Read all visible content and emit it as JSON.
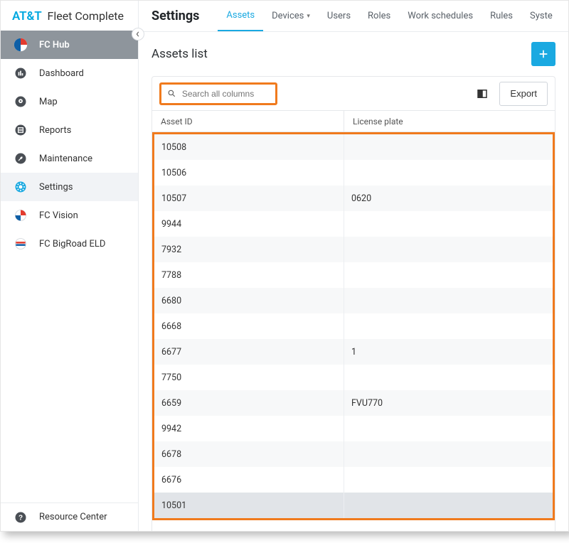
{
  "brand": {
    "att": "AT&T",
    "fc": "Fleet Complete"
  },
  "sidebar": {
    "items": [
      {
        "label": "FC Hub"
      },
      {
        "label": "Dashboard"
      },
      {
        "label": "Map"
      },
      {
        "label": "Reports"
      },
      {
        "label": "Maintenance"
      },
      {
        "label": "Settings"
      },
      {
        "label": "FC Vision"
      },
      {
        "label": "FC BigRoad ELD"
      }
    ],
    "bottom": {
      "label": "Resource Center"
    }
  },
  "topbar": {
    "title": "Settings",
    "tabs": [
      {
        "label": "Assets"
      },
      {
        "label": "Devices"
      },
      {
        "label": "Users"
      },
      {
        "label": "Roles"
      },
      {
        "label": "Work schedules"
      },
      {
        "label": "Rules"
      },
      {
        "label": "Syste"
      }
    ]
  },
  "list": {
    "title": "Assets list",
    "search_placeholder": "Search all columns",
    "export_label": "Export",
    "columns": {
      "asset_id": "Asset ID",
      "license_plate": "License plate"
    },
    "rows": [
      {
        "asset_id": "10508",
        "license_plate": ""
      },
      {
        "asset_id": "10506",
        "license_plate": ""
      },
      {
        "asset_id": "10507",
        "license_plate": "0620"
      },
      {
        "asset_id": "9944",
        "license_plate": ""
      },
      {
        "asset_id": "7932",
        "license_plate": ""
      },
      {
        "asset_id": "7788",
        "license_plate": ""
      },
      {
        "asset_id": "6680",
        "license_plate": ""
      },
      {
        "asset_id": "6668",
        "license_plate": ""
      },
      {
        "asset_id": "6677",
        "license_plate": "1"
      },
      {
        "asset_id": "7750",
        "license_plate": ""
      },
      {
        "asset_id": "6659",
        "license_plate": "FVU770"
      },
      {
        "asset_id": "9942",
        "license_plate": ""
      },
      {
        "asset_id": "6678",
        "license_plate": ""
      },
      {
        "asset_id": "6676",
        "license_plate": ""
      },
      {
        "asset_id": "10501",
        "license_plate": ""
      }
    ]
  },
  "colors": {
    "accent": "#1aa9e1",
    "highlight": "#f07a1d"
  }
}
